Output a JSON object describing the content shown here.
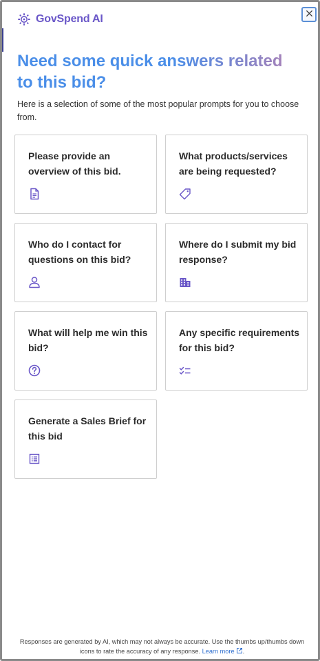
{
  "header": {
    "brand": "GovSpend AI",
    "logo_icon": "gear-sparkle-icon",
    "close_icon": "close-icon"
  },
  "intro": {
    "headline": "Need some quick answers related to this bid?",
    "subtitle": "Here is a selection of some of the most popular prompts for you to choose from."
  },
  "prompts": [
    {
      "text": "Please provide an overview of this bid.",
      "icon": "document-icon"
    },
    {
      "text": "What products/services are being requested?",
      "icon": "tag-icon"
    },
    {
      "text": "Who do I contact for questions on this bid?",
      "icon": "person-icon"
    },
    {
      "text": "Where do I submit my bid response?",
      "icon": "building-icon"
    },
    {
      "text": "What will help me win this bid?",
      "icon": "question-circle-icon"
    },
    {
      "text": "Any specific requirements for this bid?",
      "icon": "checklist-icon"
    },
    {
      "text": "Generate a Sales Brief for this bid",
      "icon": "list-box-icon"
    }
  ],
  "footer": {
    "disclaimer": "Responses are generated by AI, which may not always be accurate. Use the thumbs up/thumbs down icons to rate the accuracy of any response.",
    "learn_more": "Learn more",
    "period": "."
  },
  "colors": {
    "accent_purple": "#6a57c8",
    "headline_blue": "#4a8ee8",
    "link_blue": "#2f6fcf"
  }
}
